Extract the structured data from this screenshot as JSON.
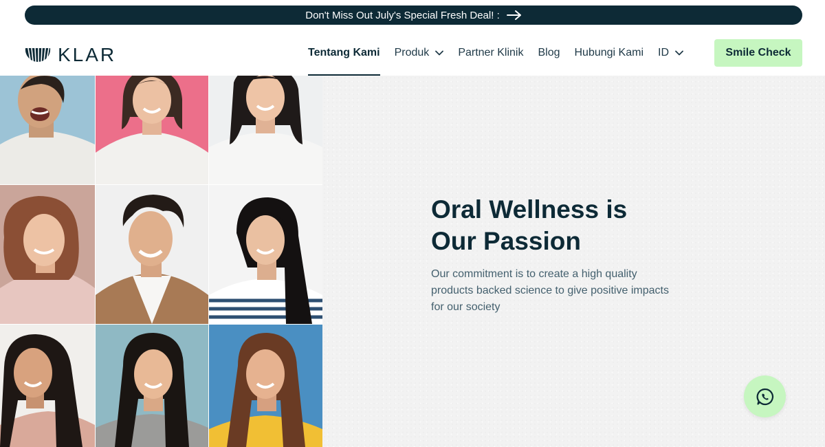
{
  "promo": {
    "text": "Don't Miss Out July's Special Fresh Deal! :",
    "arrow_icon": "arrow-right-icon"
  },
  "header": {
    "logo_text": "KLAR",
    "nav": [
      {
        "label": "Tentang Kami",
        "active": true
      },
      {
        "label": "Produk",
        "has_dropdown": true
      },
      {
        "label": "Partner Klinik"
      },
      {
        "label": "Blog"
      },
      {
        "label": "Hubungi Kami"
      },
      {
        "label": "ID",
        "has_dropdown": true
      }
    ],
    "cta_label": "Smile Check"
  },
  "hero": {
    "title_line1": "Oral Wellness is",
    "title_line2": "Our Passion",
    "description": "Our commitment is to create a high quality products backed science to give positive impacts for our society"
  },
  "photos": [
    {
      "name": "photo-laughing-man",
      "bg": "#9cc3d6"
    },
    {
      "name": "photo-woman-pink",
      "bg": "#ec6f8a"
    },
    {
      "name": "photo-woman-white",
      "bg": "#eef0f1"
    },
    {
      "name": "photo-woman-wavy",
      "bg": "#caa59a"
    },
    {
      "name": "photo-man-blazer",
      "bg": "#f0f0f0"
    },
    {
      "name": "photo-woman-stripes",
      "bg": "#f4f4f4"
    },
    {
      "name": "photo-woman-white-bg",
      "bg": "#f1efec"
    },
    {
      "name": "photo-woman-teal",
      "bg": "#8fb9c4"
    },
    {
      "name": "photo-woman-blue",
      "bg": "#4a8fc2"
    }
  ],
  "colors": {
    "navy": "#0d2a36",
    "mint": "#c6f6c0",
    "hero_bg": "#f2f2f2"
  },
  "whatsapp_icon": "whatsapp-icon"
}
